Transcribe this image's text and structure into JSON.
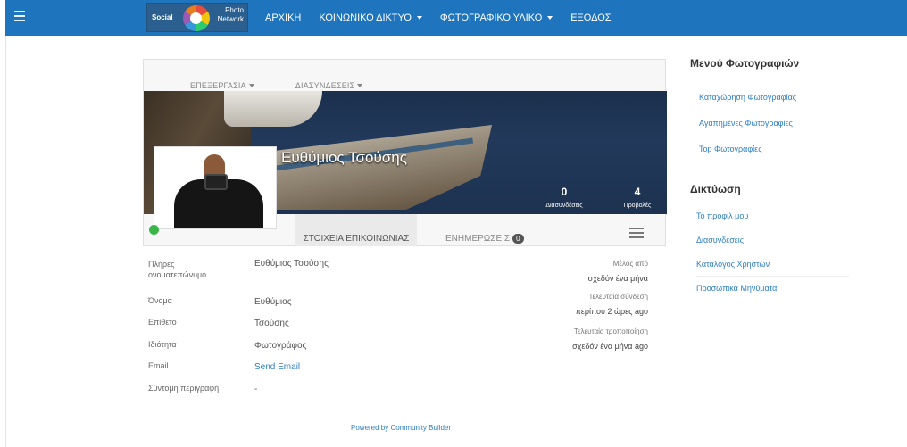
{
  "nav": {
    "brand_left": "Social",
    "brand_right_1": "Photo",
    "brand_right_2": "Network",
    "items": [
      {
        "label": "ΑΡΧΙΚΗ",
        "dropdown": false
      },
      {
        "label": "ΚΟΙΝΩΝΙΚΟ ΔΙΚΤΥΟ",
        "dropdown": true
      },
      {
        "label": "ΦΩΤΟΓΡΑΦΙΚΟ ΥΛΙΚΟ",
        "dropdown": true
      },
      {
        "label": "ΕΞΟΔΟΣ",
        "dropdown": false
      }
    ]
  },
  "profile": {
    "top_tabs": [
      "ΕΠΕΞΕΡΓΑΣΙΑ",
      "ΔΙΑΣΥΝΔΕΣΕΙΣ"
    ],
    "name": "Ευθύμιος Τσούσης",
    "stats": [
      {
        "value": "0",
        "label": "Διασυνδέσεις"
      },
      {
        "value": "4",
        "label": "Προβολές"
      }
    ],
    "tab_contact": "ΣΤΟΙΧΕΙΑ ΕΠΙΚΟΙΝΩΝΙΑΣ",
    "tab_updates": "ΕΝΗΜΕΡΩΣΕΙΣ",
    "updates_count": "0",
    "status_color": "#3bb44a"
  },
  "details": [
    {
      "label": "Πλήρες ονοματεπώνυμο",
      "value": "Ευθύμιος Τσούσης"
    },
    {
      "label": "Όνομα",
      "value": "Ευθύμιος"
    },
    {
      "label": "Επίθετο",
      "value": "Τσούσης"
    },
    {
      "label": "Ιδιότητα",
      "value": "Φωτογράφος"
    },
    {
      "label": "Email",
      "value": "Send Email"
    },
    {
      "label": "Σύντομη περιγραφή",
      "value": "-"
    }
  ],
  "meta": [
    {
      "key": "Μέλος από",
      "value": "σχεδόν ένα μήνα"
    },
    {
      "key": "Τελευταία σύνδεση",
      "value": "περίπου 2 ώρες ago"
    },
    {
      "key": "Τελευταία τροποποίηση",
      "value": "σχεδόν ένα μήνα ago"
    }
  ],
  "footer": "Powered by Community Builder",
  "sidebar": {
    "photo_menu_title": "Μενού Φωτογραφιών",
    "photo_menu": [
      "Καταχώρηση Φωτογραφίας",
      "Αγαπημένες Φωτογραφίες",
      "Top Φωτογραφίες"
    ],
    "network_title": "Δικτύωση",
    "network_menu": [
      "Το προφίλ μου",
      "Διασυνδέσεις",
      "Κατάλογος Χρηστών",
      "Προσωπικά Μηνύματα"
    ]
  },
  "colors": {
    "navbar": "#1e74bd",
    "link": "#2f7fc1"
  }
}
